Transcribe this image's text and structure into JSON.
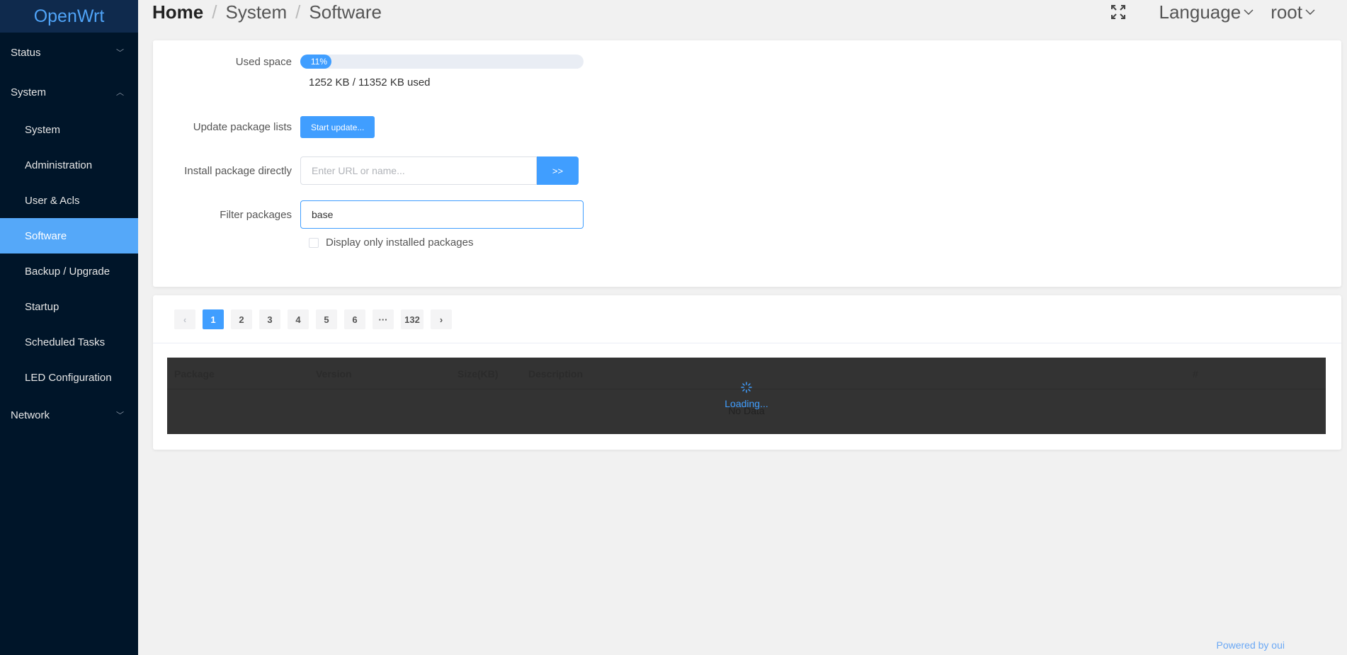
{
  "sidebar": {
    "logo": "OpenWrt",
    "groups": [
      {
        "label": "Status",
        "expanded": false
      },
      {
        "label": "System",
        "expanded": true
      },
      {
        "label": "Network",
        "expanded": false
      }
    ],
    "system_items": [
      {
        "label": "System"
      },
      {
        "label": "Administration"
      },
      {
        "label": "User & Acls"
      },
      {
        "label": "Software",
        "active": true
      },
      {
        "label": "Backup / Upgrade"
      },
      {
        "label": "Startup"
      },
      {
        "label": "Scheduled Tasks"
      },
      {
        "label": "LED Configuration"
      }
    ]
  },
  "header": {
    "breadcrumb": [
      "Home",
      "System",
      "Software"
    ],
    "separator": "/",
    "language_label": "Language",
    "user_label": "root"
  },
  "form": {
    "used_space": {
      "label": "Used space",
      "percent": 11,
      "percent_label": "11%",
      "text": "1252 KB / 11352 KB used"
    },
    "update": {
      "label": "Update package lists",
      "button": "Start update..."
    },
    "install": {
      "label": "Install package directly",
      "placeholder": "Enter URL or name...",
      "value": "",
      "button": ">>"
    },
    "filter": {
      "label": "Filter packages",
      "value": "base"
    },
    "installed_only": {
      "label": "Display only installed packages",
      "checked": false
    }
  },
  "pagination": {
    "prev": "‹",
    "next": "›",
    "pages": [
      "1",
      "2",
      "3",
      "4",
      "5",
      "6",
      "···",
      "132"
    ],
    "current": "1"
  },
  "table": {
    "columns": [
      "Package",
      "Version",
      "Size(KB)",
      "Description",
      "#"
    ],
    "empty_text": "No Data",
    "loading_text": "Loading..."
  },
  "footer": {
    "text": "Powered by oui"
  },
  "colors": {
    "primary": "#409eff",
    "sidebar_bg": "#001529",
    "active_menu": "#55a8f9"
  }
}
